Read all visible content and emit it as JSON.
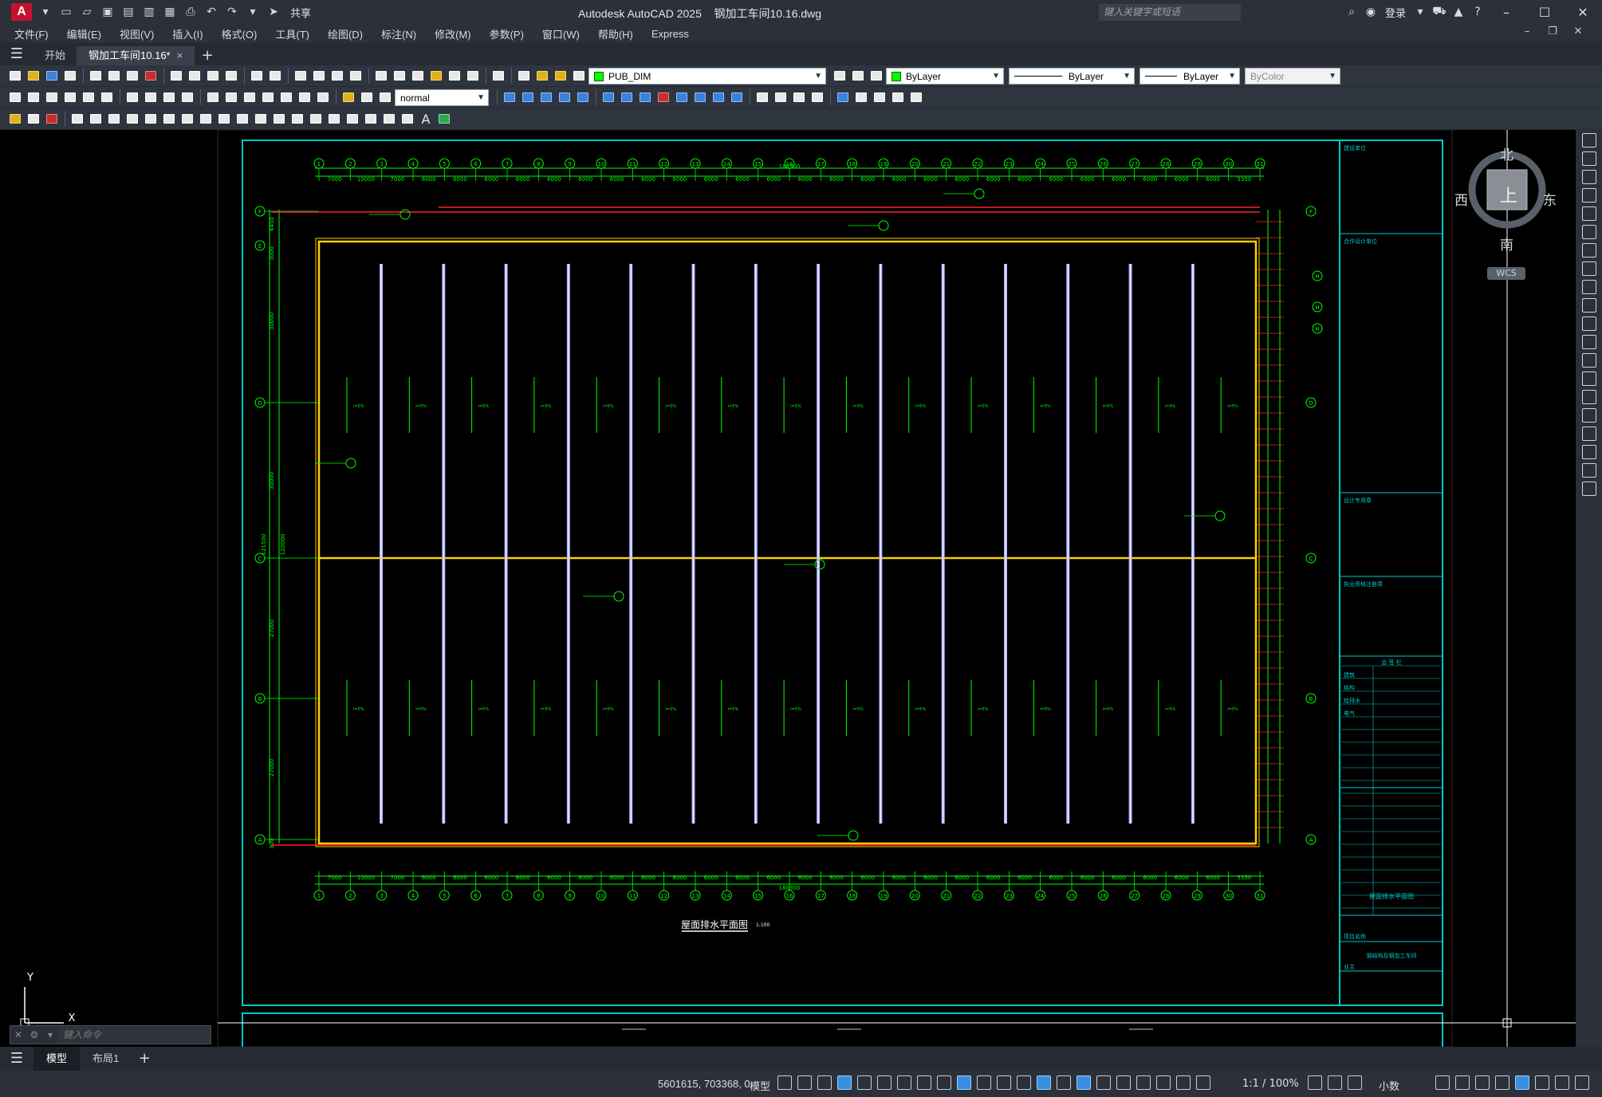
{
  "app": {
    "logo_letter": "A",
    "title": "Autodesk AutoCAD 2025    钢加工车间10.16.dwg",
    "share_label": "共享",
    "search_placeholder": "键入关键字或短语",
    "login_label": "登录"
  },
  "menu": {
    "items": [
      "文件(F)",
      "编辑(E)",
      "视图(V)",
      "插入(I)",
      "格式(O)",
      "工具(T)",
      "绘图(D)",
      "标注(N)",
      "修改(M)",
      "参数(P)",
      "窗口(W)",
      "帮助(H)",
      "Express"
    ]
  },
  "doc_tabs": [
    {
      "label": "开始"
    },
    {
      "label": "钢加工车间10.16*",
      "close": "×"
    }
  ],
  "toolbar": {
    "text_style": "normal",
    "layer": "PUB_DIM",
    "color": "ByLayer",
    "linetype": "ByLayer",
    "lineweight": "ByLayer",
    "plotstyle": "ByColor"
  },
  "colors": {
    "accent": "#3b8ede",
    "layer_swatch": "#00ff00",
    "frame": "#00c8c8",
    "grid": "#00ff00",
    "dim": "#00ff00",
    "wall": "#ffd000",
    "gutter": "#b0b0ff",
    "axis_red": "#ff2020"
  },
  "compass": {
    "north": "北",
    "south": "南",
    "east": "东",
    "west": "西",
    "top": "上",
    "wcs": "WCS"
  },
  "ucs": {
    "y_label": "Y",
    "x_label": "X"
  },
  "command": {
    "placeholder": "键入命令"
  },
  "layout_tabs": [
    {
      "label": "模型"
    },
    {
      "label": "布局1"
    }
  ],
  "drawing": {
    "title": "屋面排水平面图",
    "scale_note": "1:100",
    "top_axes": [
      "1",
      "2",
      "3",
      "4",
      "5",
      "6",
      "7",
      "8",
      "9",
      "10",
      "11",
      "12",
      "13",
      "14",
      "15",
      "16",
      "17",
      "18",
      "19",
      "20",
      "21",
      "22",
      "23",
      "24",
      "25",
      "26",
      "27",
      "28",
      "29",
      "30",
      "31"
    ],
    "row_axes": [
      "F",
      "E",
      "D",
      "C",
      "B",
      "A"
    ],
    "right_axes": [
      "H",
      "H",
      "H"
    ],
    "spacing_labels": [
      "7000",
      "10000",
      "7000",
      "6000",
      "6000",
      "6000",
      "6000",
      "6000",
      "6000",
      "6000",
      "6000",
      "6000",
      "6000",
      "6000",
      "6000",
      "6000",
      "6000",
      "6000",
      "6000",
      "6000",
      "6000",
      "6000",
      "6000",
      "6000",
      "6000",
      "6000",
      "6000",
      "6000",
      "6000",
      "5350",
      "650",
      "400"
    ],
    "total_top": "180300",
    "total_bottom": "180300",
    "left_dims": [
      "6450",
      "3000",
      "30000",
      "30000",
      "27000",
      "27000",
      "300"
    ],
    "left_total": "121500",
    "left_sub": "120000",
    "bottom_sub": [
      "4550",
      "900",
      "4550",
      "2550",
      "2550"
    ],
    "pipe_label": "i=5%"
  },
  "title_block": {
    "header_1": "建设单位",
    "header_2": "合作设计单位",
    "header_3": "设计专用章",
    "header_4": "执业资格注册章",
    "sign_header": "会 签 栏",
    "sign_rows": [
      "建筑",
      "结构",
      "给排水",
      "电气"
    ],
    "project_label": "项目名称",
    "project_name": "钢结构及钢加工车间",
    "drawing_name": "屋面排水平面图",
    "owner": "业主"
  },
  "status": {
    "coords": "5601615, 703368, 0",
    "model": "模型",
    "scale": "1:1 / 100%",
    "units": "小数"
  }
}
